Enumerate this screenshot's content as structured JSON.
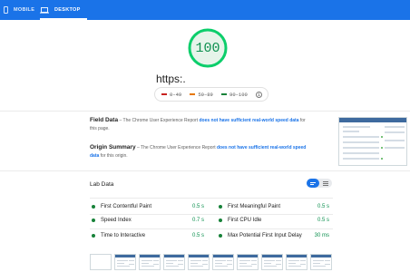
{
  "tabs": {
    "mobile": "MOBILE",
    "desktop": "DESKTOP"
  },
  "colors": {
    "brand": "#1a73e8",
    "pass": "#178239",
    "average": "#e67700",
    "fail": "#c7221f"
  },
  "score": {
    "value": "100",
    "fraction": 1.0
  },
  "url": "https:.",
  "legend": {
    "fail": "0–49",
    "average": "50–89",
    "pass": "90–100",
    "info_icon": "info-icon"
  },
  "field_data": {
    "title": "Field Data",
    "text_before": " – The Chrome User Experience Report ",
    "link": "does not have sufficient real-world speed data",
    "text_after": " for this page."
  },
  "origin_summary": {
    "title": "Origin Summary",
    "text_before": " – The Chrome User Experience Report ",
    "link": "does not have sufficient real-world speed data",
    "text_after": " for this origin."
  },
  "lab": {
    "title": "Lab Data",
    "metrics": [
      {
        "name": "First Contentful Paint",
        "value": "0.5 s"
      },
      {
        "name": "First Meaningful Paint",
        "value": "0.5 s"
      },
      {
        "name": "Speed Index",
        "value": "0.7 s"
      },
      {
        "name": "First CPU Idle",
        "value": "0.5 s"
      },
      {
        "name": "Time to Interactive",
        "value": "0.5 s"
      },
      {
        "name": "Max Potential First Input Delay",
        "value": "30 ms"
      }
    ]
  },
  "filmstrip_frames": 10
}
